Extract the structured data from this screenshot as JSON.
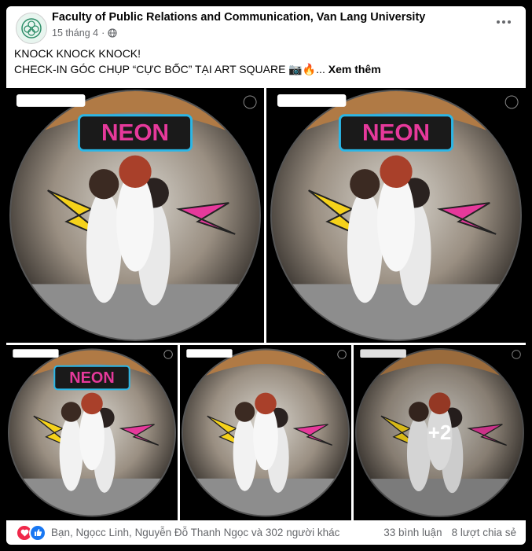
{
  "post": {
    "page_name": "Faculty of Public Relations and Communication, Van Lang University",
    "date": "15 tháng 4",
    "separator": "·",
    "privacy_icon": "globe-icon",
    "more_icon": "more-dots-icon",
    "text_line1": "KNOCK KNOCK KNOCK!",
    "text_line2": "CHECK-IN GÓC CHỤP “CỰC BỐC” TẠI ART SQUARE 📷🔥...",
    "see_more": "Xem thêm"
  },
  "photos": {
    "count": 5,
    "overlay_label": "+2",
    "sign_text": "NEON"
  },
  "footer": {
    "reactions": [
      "love-icon",
      "like-icon"
    ],
    "reaction_names": "Bạn, Ngọcc Linh, Nguyễn Đỗ Thanh Ngọc và 302 người khác",
    "comments": "33 bình luận",
    "shares": "8 lượt chia sẻ"
  },
  "colors": {
    "name_text": "#050505",
    "meta_text": "#65676b",
    "love": "#f0284a",
    "like": "#1877f2",
    "neon_pink": "#e6399b",
    "neon_yellow": "#f5d21a",
    "neon_blue": "#2bb6e6"
  }
}
